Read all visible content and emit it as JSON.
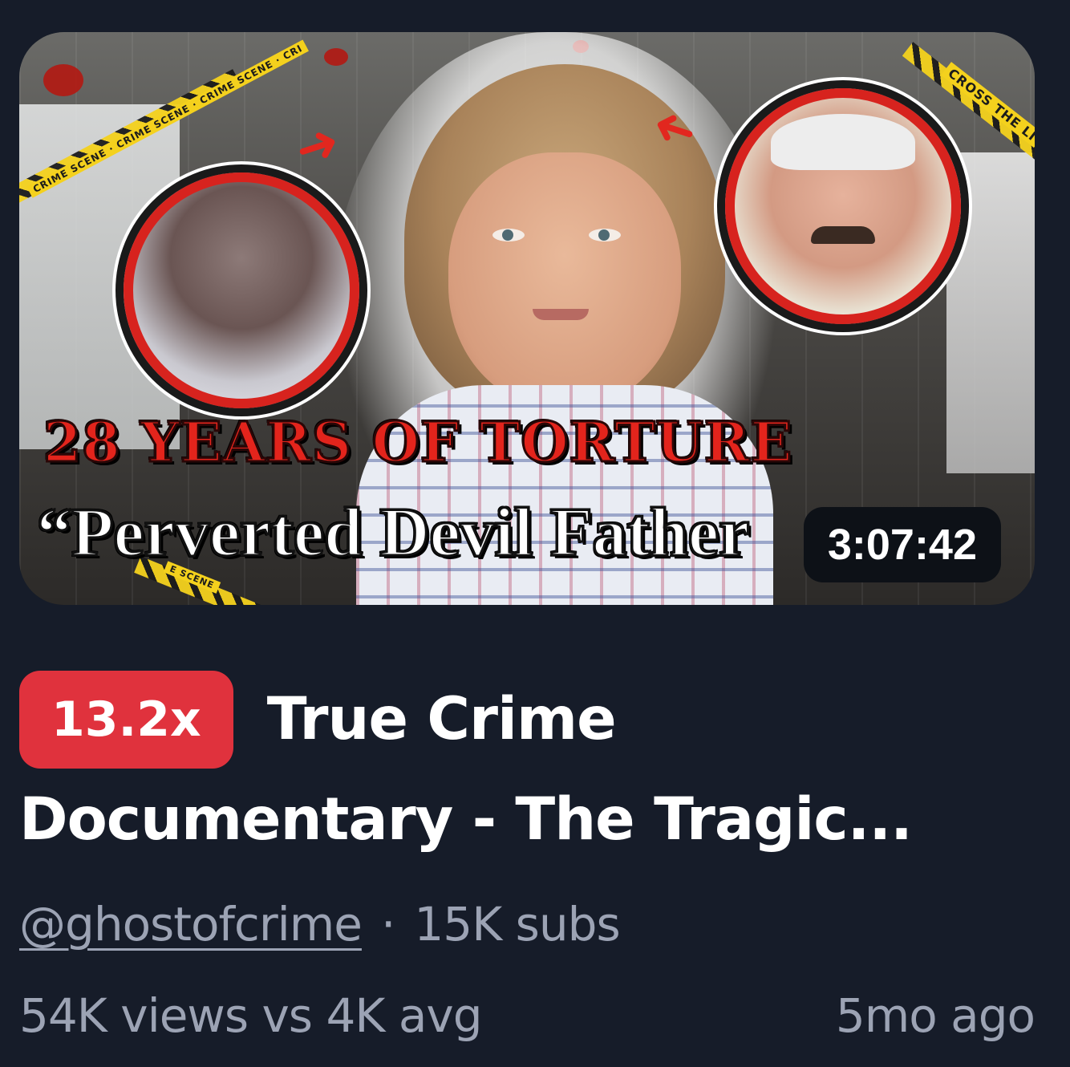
{
  "thumbnail": {
    "headline_top": "28 YEARS OF TORTURE",
    "headline_bottom": "“Perverted Devil Father",
    "tape_left": "CRIME SCENE · CRIME SCENE · CRIME SCENE · CRI",
    "tape_right": "CROSS THE LI",
    "tape_bottom": "E SCENE",
    "duration": "3:07:42",
    "colors": {
      "accent_red": "#e3241c",
      "tape_yellow": "#f4d11d"
    }
  },
  "video": {
    "multiplier_badge": "13.2x",
    "title_line1": "True Crime",
    "title_line2": "Documentary - The Tragic...",
    "channel": "@ghostofcrime",
    "separator": "·",
    "subscribers": "15K subs",
    "views_comparison": "54K views vs 4K avg",
    "age": "5mo ago"
  },
  "colors": {
    "background": "#161c29",
    "badge_red": "#e0323d",
    "muted_text": "#9ca3b4",
    "title_text": "#ffffff"
  }
}
